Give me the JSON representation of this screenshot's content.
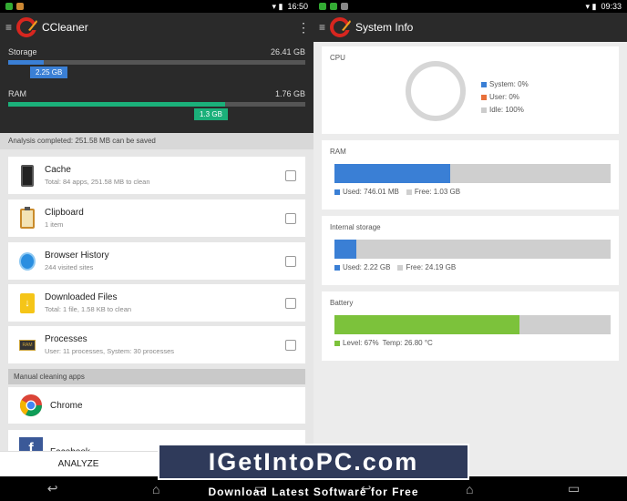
{
  "left": {
    "status_time": "16:50",
    "app_title": "CCleaner",
    "storage": {
      "label": "Storage",
      "total": "26.41 GB",
      "used": "2.25 GB",
      "fill": 0.12,
      "color": "#3a7fd5"
    },
    "ram": {
      "label": "RAM",
      "total": "1.76 GB",
      "used": "1.3 GB",
      "fill": 0.73,
      "color": "#1bb07a"
    },
    "analysis": "Analysis completed: 251.58 MB can be saved",
    "items": [
      {
        "title": "Cache",
        "sub": "Total: 84 apps, 251.58 MB to clean",
        "icon": "phone-icon"
      },
      {
        "title": "Clipboard",
        "sub": "1 item",
        "icon": "clipboard-icon"
      },
      {
        "title": "Browser History",
        "sub": "244 visited sites",
        "icon": "globe-icon"
      },
      {
        "title": "Downloaded Files",
        "sub": "Total: 1 file, 1.58 KB to clean",
        "icon": "download-file-icon"
      },
      {
        "title": "Processes",
        "sub": "User: 11 processes, System: 30 processes",
        "icon": "ram-chip-icon"
      }
    ],
    "manual_section": "Manual cleaning apps",
    "apps": [
      {
        "title": "Chrome",
        "icon": "chrome-icon"
      },
      {
        "title": "Facebook",
        "icon": "facebook-icon"
      }
    ],
    "analyze_label": "ANALYZE"
  },
  "right": {
    "status_time": "09:33",
    "app_title": "System Info",
    "cpu": {
      "label": "CPU",
      "system": "System: 0%",
      "user": "User: 0%",
      "idle": "Idle: 100%",
      "system_color": "#3a7fd5",
      "user_color": "#e8703a",
      "idle_color": "#cccccc"
    },
    "ram": {
      "label": "RAM",
      "used": "Used: 746.01 MB",
      "free": "Free: 1.03 GB",
      "fill": 0.42,
      "color": "#3a7fd5"
    },
    "storage": {
      "label": "Internal storage",
      "used": "Used: 2.22 GB",
      "free": "Free: 24.19 GB",
      "fill": 0.08,
      "color": "#3a7fd5"
    },
    "battery": {
      "label": "Battery",
      "level": "Level: 67%",
      "temp": "Temp: 26.80 °C",
      "fill": 0.67,
      "color": "#7cc23b"
    }
  },
  "watermark": {
    "main": "IGetIntoPC.com",
    "sub": "Download Latest Software for Free"
  }
}
